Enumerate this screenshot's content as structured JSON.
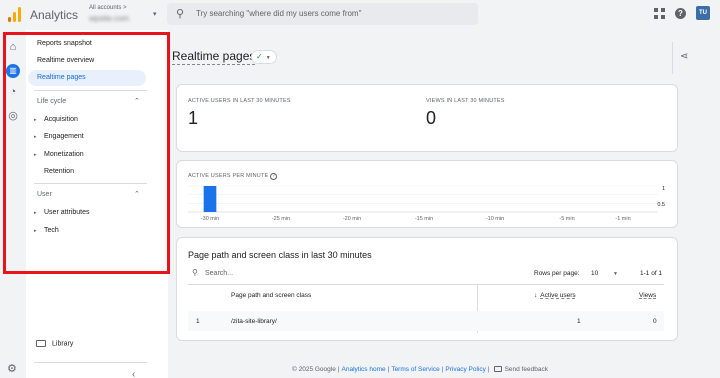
{
  "header": {
    "app_title": "Analytics",
    "account_line": "All accounts >",
    "account_name": "wpsite.com",
    "search_placeholder": "Try searching \"where did my users come from\"",
    "avatar_text": "TU"
  },
  "nav": {
    "items": [
      {
        "label": "Reports snapshot"
      },
      {
        "label": "Realtime overview"
      },
      {
        "label": "Realtime pages",
        "selected": true
      }
    ],
    "sections": [
      {
        "label": "Life cycle",
        "items": [
          "Acquisition",
          "Engagement",
          "Monetization",
          "Retention"
        ]
      },
      {
        "label": "User",
        "items": [
          "User attributes",
          "Tech"
        ]
      }
    ],
    "library_label": "Library",
    "collapse_icon": "chevron-left-icon"
  },
  "page": {
    "title": "Realtime pages",
    "status_icon": "check-circle-icon",
    "share_icon": "share-icon"
  },
  "metrics": [
    {
      "label": "ACTIVE USERS IN LAST 30 MINUTES",
      "value": "1"
    },
    {
      "label": "VIEWS IN LAST 30 MINUTES",
      "value": "0"
    }
  ],
  "chart_data": {
    "type": "bar",
    "title": "ACTIVE USERS PER MINUTE",
    "tick_labels": [
      "-30 min",
      "-25 min",
      "-20 min",
      "-15 min",
      "-10 min",
      "-5 min",
      "-1 min"
    ],
    "y_ticks": [
      "1",
      "0.5"
    ],
    "ylim": [
      0,
      1
    ],
    "values": [
      0,
      1,
      0,
      0,
      0,
      0,
      0,
      0,
      0,
      0,
      0,
      0,
      0,
      0,
      0,
      0,
      0,
      0,
      0,
      0,
      0,
      0,
      0,
      0,
      0,
      0,
      0,
      0,
      0,
      0
    ],
    "bar_color": "#1a73e8"
  },
  "table": {
    "title": "Page path and screen class in last 30 minutes",
    "search_placeholder": "Search...",
    "rows_per_page_label": "Rows per page:",
    "rows_per_page": "10",
    "range": "1-1 of 1",
    "columns": [
      "Page path and screen class",
      "Active users",
      "Views"
    ],
    "sort_icon": "arrow-down-icon",
    "rows": [
      {
        "index": "1",
        "path": "/zita-site-library/",
        "active_users": "1",
        "views": "0"
      }
    ]
  },
  "footer": {
    "copyright": "© 2025 Google",
    "links": [
      "Analytics home",
      "Terms of Service",
      "Privacy Policy"
    ],
    "feedback": "Send feedback"
  },
  "colors": {
    "accent": "#1a73e8",
    "highlight_border": "#e8131b"
  }
}
